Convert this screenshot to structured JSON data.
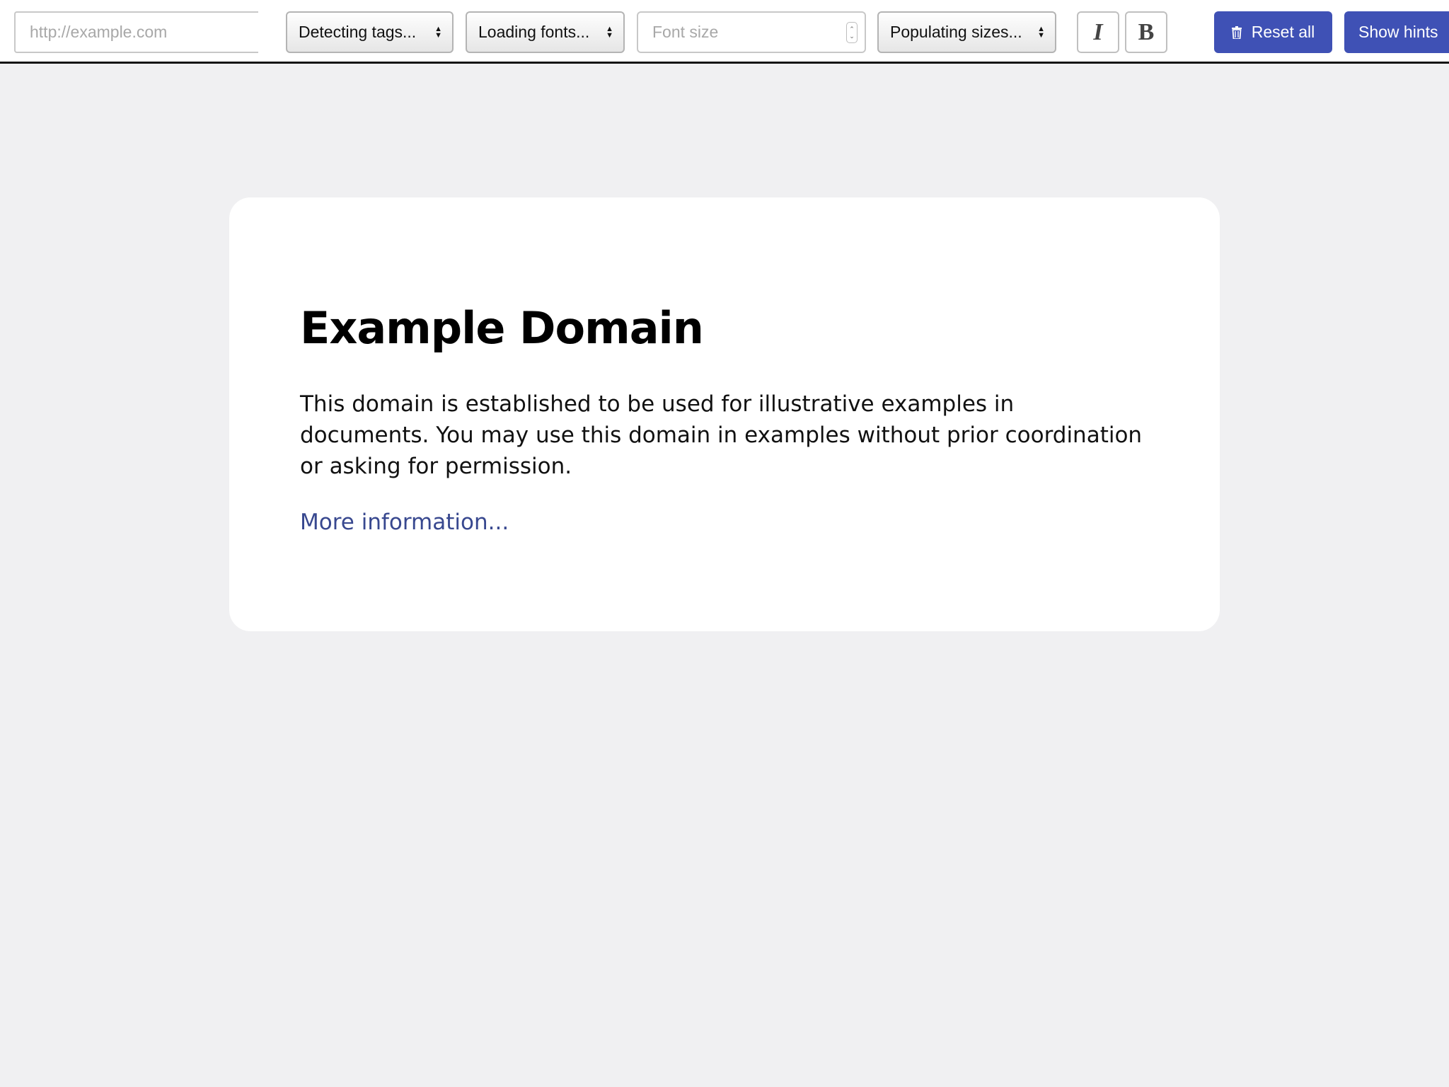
{
  "toolbar": {
    "url_placeholder": "http://example.com",
    "tag_select": "Detecting tags...",
    "font_select": "Loading fonts...",
    "font_size_placeholder": "Font size",
    "size_select": "Populating sizes...",
    "italic_label": "I",
    "bold_label": "B",
    "reset_label": "Reset all",
    "reset_icon": "trash-icon",
    "hints_label": "Show hints",
    "accent_color": "#3f51b5"
  },
  "page": {
    "title": "Example Domain",
    "body": "This domain is established to be used for illustrative examples in documents. You may use this domain in examples without prior coordination or asking for permission.",
    "link_text": "More information...",
    "link_color": "#38488f",
    "background_color": "#f0f0f2"
  }
}
